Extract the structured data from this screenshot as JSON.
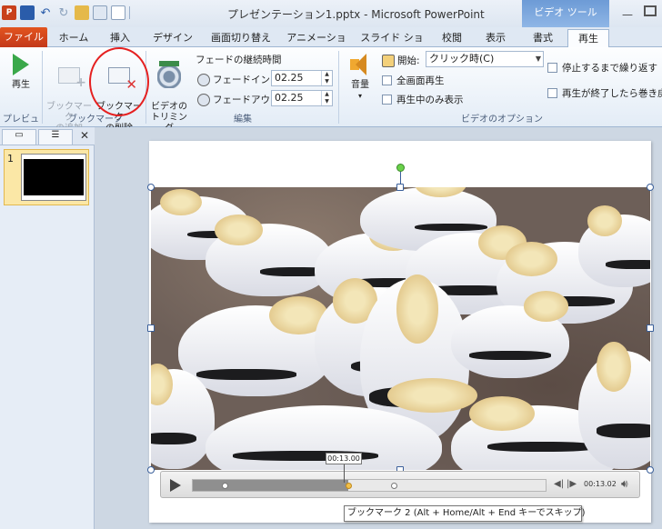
{
  "window": {
    "title": "プレゼンテーション1.pptx - Microsoft PowerPoint",
    "context_tab_header": "ビデオ ツール"
  },
  "qat": {
    "icons": [
      "powerpoint-app-icon",
      "save-icon",
      "undo-icon",
      "redo-icon",
      "open-icon",
      "print-preview-icon",
      "new-icon"
    ]
  },
  "tabs": {
    "file": "ファイル",
    "home": "ホーム",
    "insert": "挿入",
    "design": "デザイン",
    "transitions": "画面切り替え",
    "animations": "アニメーション",
    "slideshow": "スライド ショー",
    "review": "校閲",
    "view": "表示",
    "format": "書式",
    "playback": "再生"
  },
  "ribbon": {
    "preview": {
      "play_label": "再生",
      "group": "プレビュー"
    },
    "bookmarks": {
      "add_label": "ブックマーク\nの追加",
      "remove_label": "ブックマーク\nの削除",
      "group": "ブックマーク"
    },
    "editing": {
      "trim_label": "ビデオの\nトリミング",
      "fade_duration": "フェードの継続時間",
      "fade_in_label": "フェードイン:",
      "fade_in_value": "02.25",
      "fade_out_label": "フェードアウト:",
      "fade_out_value": "02.25",
      "group": "編集"
    },
    "video_options": {
      "volume_label": "音量",
      "start_label": "開始:",
      "start_value": "クリック時(C)",
      "fullscreen_label": "全画面再生",
      "hide_label": "再生中のみ表示",
      "loop_label": "停止するまで繰り返す",
      "rewind_label": "再生が終了したら巻き戻",
      "group": "ビデオのオプション"
    }
  },
  "slide_pane": {
    "slide_number": "1"
  },
  "player": {
    "hover_time": "00:13.00",
    "current_time": "00:13.02",
    "progress_fraction": 0.44,
    "bookmarks": [
      0.09,
      0.44,
      0.57
    ],
    "tooltip": "ブックマーク 2 (Alt + Home/Alt + End キーでスキップ)"
  }
}
